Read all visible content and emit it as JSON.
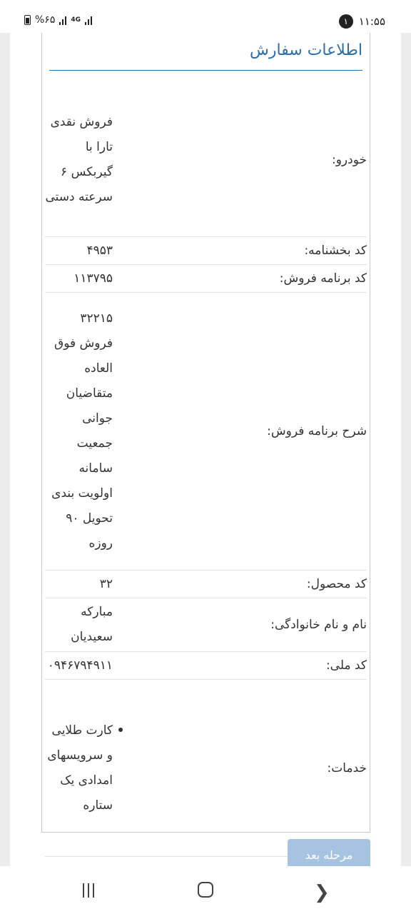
{
  "status_bar": {
    "time": "۱۱:۵۵",
    "notification_count": "۱",
    "battery": "%۶۵",
    "network": "4G"
  },
  "panel": {
    "title": "اطلاعات سفارش"
  },
  "order": {
    "car_label": "خودرو:",
    "car_value": "فروش نقدی تارا با گیربکس ۶ سرعته دستی",
    "bakhshnameh_label": "کد بخشنامه:",
    "bakhshnameh_value": "۴۹۵۳",
    "program_code_label": "کد برنامه فروش:",
    "program_code_value": "۱۱۳۷۹۵",
    "program_desc_label": "شرح برنامه فروش:",
    "program_desc_value": "۳۲۲۱۵ فروش فوق العاده متقاضیان جوانی جمعیت سامانه اولویت بندی تحویل ۹۰ روزه",
    "product_code_label": "کد محصول:",
    "product_code_value": "۳۲",
    "name_label": "نام و نام خانوادگی:",
    "name_value": "مبارکه سعیدیان",
    "national_id_label": "کد ملی:",
    "national_id_value": "۰۹۴۶۷۹۴۹۱۱",
    "services_label": "خدمات:",
    "services_items": [
      "کارت طلایی و سرویسهای امدادی یک ستاره"
    ]
  },
  "actions": {
    "next_label": "مرحله بعد"
  },
  "colors": {
    "accent": "#2a6fa8",
    "button": "#a6c4e2"
  }
}
